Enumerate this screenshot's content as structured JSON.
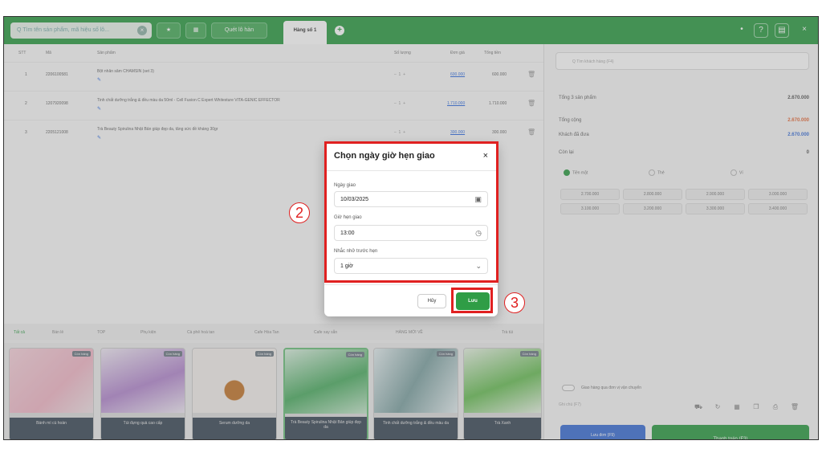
{
  "topbar": {
    "search_placeholder": "Q Tìm tên sản phẩm, mã hiệu số lô...",
    "btn_deal": "Quét lô hàn",
    "active_tab": "Hàng số 1",
    "add_tab": "+"
  },
  "table": {
    "headers": [
      "STT",
      "Mã",
      "Sản phẩm",
      "Số lượng",
      "Đơn giá",
      "Tổng tiền"
    ],
    "rows": [
      {
        "stt": "1",
        "code": "2206100581",
        "name": "Bột nhân sâm CHAMSIN (set 3)",
        "price": "600.000",
        "total": "600.000"
      },
      {
        "stt": "2",
        "code": "1207920098",
        "name": "Tinh chất dưỡng trắng & đều màu da 50ml - Cell Fusion C Expert Whitesture VITA-GENIC EFFECTOR",
        "price": "1.710.000",
        "total": "1.710.000"
      },
      {
        "stt": "3",
        "code": "2205121008",
        "name": "Trà Beauty Spirulina Nhật Bản giúp đẹp da, tăng sức đề kháng 30gr",
        "price": "300.000",
        "total": "300.000"
      }
    ]
  },
  "categories": [
    "Tất cả",
    "Bán lẻ",
    "TOP",
    "Phụ kiện",
    "Cà phê hoà tan",
    "Cafe Hòa Tan",
    "Cafe xay sẵn",
    "HÀNG MỚI VỀ",
    "Trà túi"
  ],
  "products": [
    {
      "caption": "Bánh mì cù hoàn",
      "tag": "Còn hàng"
    },
    {
      "caption": "Túi đựng quà cao cấp",
      "tag": "Còn hàng"
    },
    {
      "caption": "Serum dưỡng da",
      "tag": "Còn hàng"
    },
    {
      "caption": "Trà Beauty Spirulina Nhật Bản giúp đẹp da",
      "tag": "Còn hàng"
    },
    {
      "caption": "Tinh chất dưỡng trắng & đều màu da",
      "tag": "Còn hàng"
    },
    {
      "caption": "Trà Xanh",
      "tag": "Còn hàng"
    }
  ],
  "right": {
    "customer_placeholder": "Q Tìm khách hàng (F4)",
    "sum_label": "Tổng 3 sản phẩm",
    "sum_value": "2.670.000",
    "total_label": "Tổng cộng",
    "total_value": "2.670.000",
    "paid_label": "Khách đã đưa",
    "paid_value": "2.670.000",
    "change_label": "Còn lại",
    "change_value": "0",
    "pay_methods": [
      "Tiền mặt",
      "Thẻ",
      "Ví"
    ],
    "quick_amounts": [
      "2.700.000",
      "2.800.000",
      "2.900.000",
      "3.000.000",
      "3.100.000",
      "3.200.000",
      "3.300.000",
      "3.400.000"
    ],
    "delivery_note": "Giao hàng qua đơn vị vận chuyển",
    "note_placeholder": "Ghi chú (F7)",
    "btn_save_order": "Lưu đơn (F9)",
    "btn_pay": "Thanh toán (F3)"
  },
  "modal": {
    "title": "Chọn ngày giờ hẹn giao",
    "close_symbol": "×",
    "date_label": "Ngày giao",
    "date_value": "10/03/2025",
    "time_label": "Giờ hẹn giao",
    "time_value": "13:00",
    "remind_label": "Nhắc nhở trước hẹn",
    "remind_value": "1 giờ",
    "cancel": "Hủy",
    "save": "Lưu"
  },
  "markers": {
    "step2": "2",
    "step3": "3"
  },
  "colors": {
    "brand_green": "#2f9d46",
    "highlight_red": "#e02020",
    "accent_blue": "#3d70d6"
  },
  "icons": {
    "date": "calendar-icon",
    "time": "clock-icon",
    "remind": "chevron-down-icon"
  }
}
